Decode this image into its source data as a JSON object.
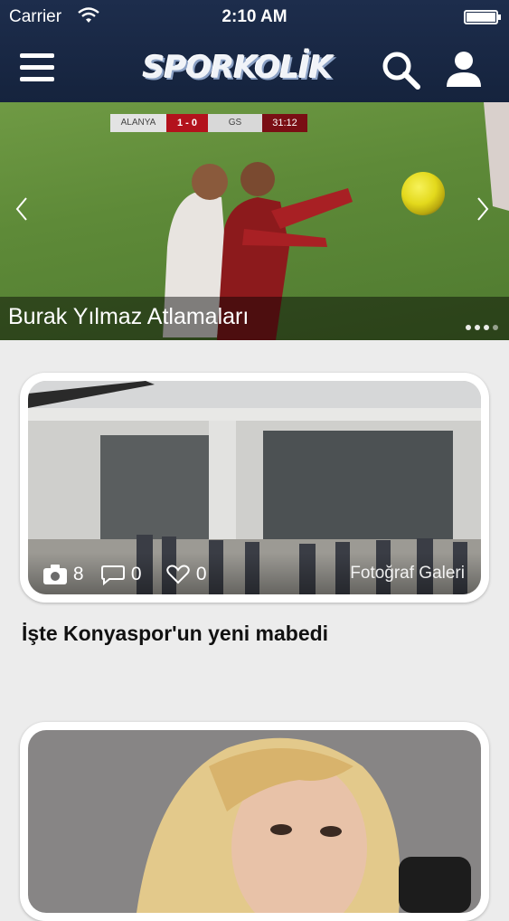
{
  "status_bar": {
    "carrier": "Carrier",
    "time": "2:10 AM"
  },
  "header": {
    "logo_text": "SPORKOLİK",
    "icons": [
      "menu-icon",
      "search-icon",
      "user-icon"
    ]
  },
  "hero": {
    "caption": "Burak Yılmaz Atlamaları",
    "scoreboard": {
      "home": "ALANYA",
      "score": "1 - 0",
      "away": "GS",
      "clock": "31:12"
    },
    "page_dots": 4
  },
  "articles": [
    {
      "title": "İşte Konyaspor'un yeni mabedi",
      "photo_count": "8",
      "comment_count": "0",
      "like_count": "0",
      "category": "Fotoğraf Galeri"
    }
  ],
  "colors": {
    "header_bg": "#1a2946",
    "page_bg": "#ececec",
    "card_bg": "#ffffff"
  }
}
